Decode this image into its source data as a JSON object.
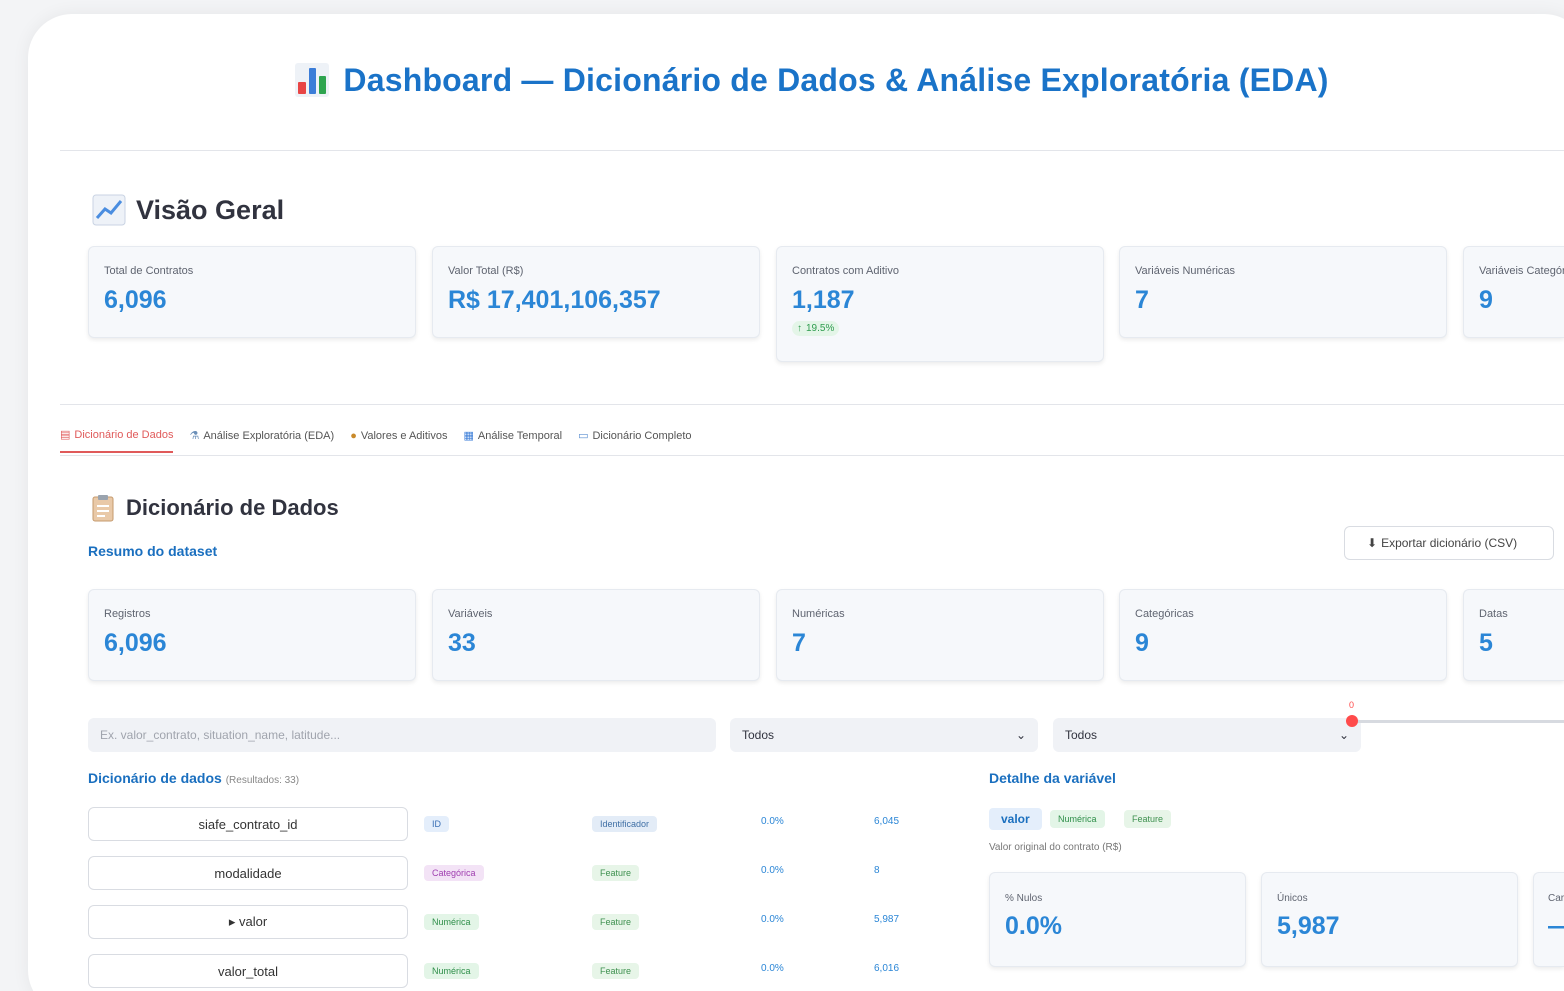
{
  "header": {
    "title": "Dashboard — Dicionário de Dados & Análise Exploratória (EDA)"
  },
  "overview": {
    "heading": "Visão Geral",
    "metrics": [
      {
        "label": "Total de Contratos",
        "value": "6,096"
      },
      {
        "label": "Valor Total (R$)",
        "value": "R$ 17,401,106,357"
      },
      {
        "label": "Contratos com Aditivo",
        "value": "1,187",
        "delta": "19.5%"
      },
      {
        "label": "Variáveis Numéricas",
        "value": "7"
      },
      {
        "label": "Variáveis Categóricas",
        "value": "9"
      }
    ]
  },
  "tabs": [
    {
      "label": "Dicionário de Dados",
      "icon": "clipboard-icon",
      "active": true
    },
    {
      "label": "Análise Exploratória (EDA)",
      "icon": "flask-icon",
      "active": false
    },
    {
      "label": "Valores e Aditivos",
      "icon": "money-bag-icon",
      "active": false
    },
    {
      "label": "Análise Temporal",
      "icon": "calendar-icon",
      "active": false
    },
    {
      "label": "Dicionário Completo",
      "icon": "book-icon",
      "active": false
    }
  ],
  "dictionary": {
    "heading": "Dicionário de Dados",
    "summary_heading": "Resumo do dataset",
    "export_label": "Exportar dicionário (CSV)",
    "summary_metrics": [
      {
        "label": "Registros",
        "value": "6,096"
      },
      {
        "label": "Variáveis",
        "value": "33"
      },
      {
        "label": "Numéricas",
        "value": "7"
      },
      {
        "label": "Categóricas",
        "value": "9"
      },
      {
        "label": "Datas",
        "value": "5"
      }
    ],
    "search_placeholder": "Ex. valor_contrato, situation_name, latitude...",
    "filter_type": "Todos",
    "filter_role": "Todos",
    "slider_value": "0",
    "table_heading": "Dicionário de dados",
    "table_subheading": "(Resultados: 33)",
    "rows": [
      {
        "name": "siafe_contrato_id",
        "type": "ID",
        "role": "Identificador",
        "nulls": "0.0%",
        "unique": "6,045"
      },
      {
        "name": "modalidade",
        "type": "Categórica",
        "role": "Feature",
        "nulls": "0.0%",
        "unique": "8"
      },
      {
        "name": "▸ valor",
        "type": "Numérica",
        "role": "Feature",
        "nulls": "0.0%",
        "unique": "5,987"
      },
      {
        "name": "valor_total",
        "type": "Numérica",
        "role": "Feature",
        "nulls": "0.0%",
        "unique": "6,016"
      }
    ]
  },
  "detail": {
    "heading": "Detalhe da variável",
    "variable": "valor",
    "type": "Numérica",
    "role": "Feature",
    "description": "Valor original do contrato (R$)",
    "cards": [
      {
        "label": "% Nulos",
        "value": "0.0%"
      },
      {
        "label": "Únicos",
        "value": "5,987"
      },
      {
        "label": "Cardinalidade",
        "value": "—"
      }
    ]
  },
  "colors": {
    "accent": "#1a73c8",
    "metric_value": "#2b86d6",
    "active_tab": "#e05a5a"
  }
}
